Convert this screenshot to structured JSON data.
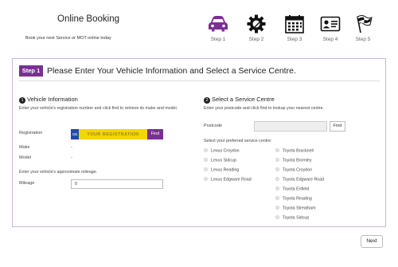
{
  "header": {
    "title": "Online Booking",
    "subtitle": "Book your next Service or MOT online today"
  },
  "steps": [
    {
      "label": "Step 1",
      "icon": "car-icon",
      "active": true,
      "color": "#7a2f93"
    },
    {
      "label": "Step 2",
      "icon": "gear-icon",
      "active": false,
      "color": "#111111"
    },
    {
      "label": "Step 3",
      "icon": "calendar-icon",
      "active": false,
      "color": "#111111"
    },
    {
      "label": "Step 4",
      "icon": "id-card-icon",
      "active": false,
      "color": "#111111"
    },
    {
      "label": "Step 5",
      "icon": "finish-flag-icon",
      "active": false,
      "color": "#111111"
    }
  ],
  "panel": {
    "step_badge": "Step 1",
    "title": "Please Enter Your Vehicle Information and Select a Service Centre."
  },
  "vehicle": {
    "number": "1",
    "heading": "Vehicle Information",
    "instructions": "Enter your vehicle's registration number and click find to retrieve its make and model.",
    "registration_label": "Registration",
    "gb_label": "GB",
    "registration_placeholder": "YOUR REGISTRATION",
    "find_label": "Find",
    "make_label": "Make",
    "make_value": "-",
    "model_label": "Model",
    "model_value": "-",
    "mileage_instructions": "Enter your vehicle's approximate mileage.",
    "mileage_label": "Mileage",
    "mileage_value": "0"
  },
  "centre": {
    "number": "2",
    "heading": "Select a Service Centre",
    "instructions": "Enter your postcode and click find to lookup your nearest centre.",
    "postcode_label": "Postcode",
    "postcode_value": "",
    "find_label": "Find",
    "select_label": "Select your preferred service centre:",
    "lexus_centres": [
      "Lexus Croydon",
      "Lexus Sidcup",
      "Lexus Reading",
      "Lexus Edgware Road"
    ],
    "toyota_centres": [
      "Toyota Bracknell",
      "Toyota Bromley",
      "Toyota Croydon",
      "Toyota Edgware Road",
      "Toyota Enfield",
      "Toyota Reading",
      "Toyota Streatham",
      "Toyota Sidcup"
    ]
  },
  "footer": {
    "next_label": "Next"
  },
  "colors": {
    "accent": "#7a2f93",
    "plate_yellow": "#f4d600",
    "plate_blue": "#1f4aa8"
  }
}
